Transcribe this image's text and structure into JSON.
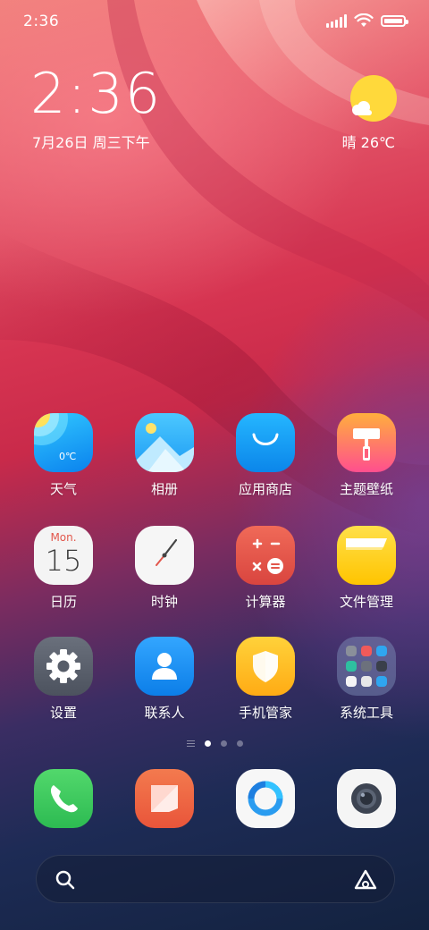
{
  "status_bar": {
    "time": "2:36",
    "icons": [
      "signal-icon",
      "wifi-icon",
      "battery-icon"
    ]
  },
  "clock_widget": {
    "time": "2:36",
    "date": "7月26日 周三下午"
  },
  "weather_widget": {
    "condition": "晴",
    "temperature": "26℃",
    "display": "晴 26℃",
    "icon": "sunny-cloud-icon"
  },
  "apps": [
    {
      "id": "weather",
      "label": "天气",
      "icon": "weather-icon",
      "badge_text": "0℃"
    },
    {
      "id": "gallery",
      "label": "相册",
      "icon": "gallery-icon"
    },
    {
      "id": "app-store",
      "label": "应用商店",
      "icon": "app-store-icon"
    },
    {
      "id": "themes",
      "label": "主题壁纸",
      "icon": "themes-icon"
    },
    {
      "id": "calendar",
      "label": "日历",
      "icon": "calendar-icon",
      "month": "Mon.",
      "day": "15"
    },
    {
      "id": "clock",
      "label": "时钟",
      "icon": "clock-icon"
    },
    {
      "id": "calculator",
      "label": "计算器",
      "icon": "calculator-icon"
    },
    {
      "id": "file-manager",
      "label": "文件管理",
      "icon": "file-manager-icon"
    },
    {
      "id": "settings",
      "label": "设置",
      "icon": "settings-icon"
    },
    {
      "id": "contacts",
      "label": "联系人",
      "icon": "contacts-icon"
    },
    {
      "id": "security",
      "label": "手机管家",
      "icon": "security-icon"
    },
    {
      "id": "system-tools",
      "label": "系统工具",
      "icon": "folder-icon"
    }
  ],
  "page_indicator": {
    "pages": 3,
    "current": 1
  },
  "dock": [
    {
      "id": "phone",
      "icon": "phone-icon"
    },
    {
      "id": "messages",
      "icon": "messages-icon"
    },
    {
      "id": "browser",
      "icon": "browser-icon"
    },
    {
      "id": "camera",
      "icon": "camera-icon"
    }
  ],
  "search_bar": {
    "left_icon": "search-icon",
    "right_icon": "assistant-icon"
  },
  "colors": {
    "weather_icon": "#1fa8f5",
    "app_store": "#1a9cf0",
    "themes": "#ff5b8a",
    "calculator": "#e2574c",
    "file_manager": "#ffd21c",
    "settings": "#5d6370",
    "contacts": "#1e8ff0",
    "security": "#ffbf1a",
    "phone": "#3ec95f",
    "messages": "#f0643f"
  }
}
